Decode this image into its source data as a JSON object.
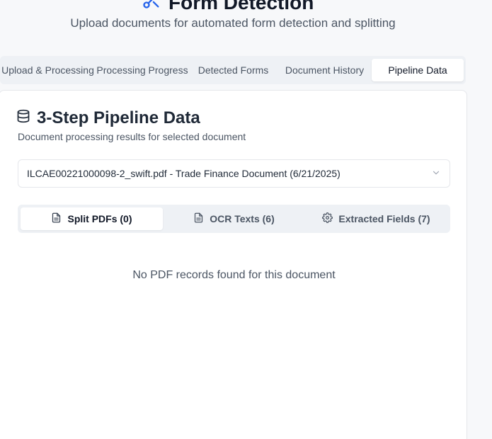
{
  "header": {
    "title": "Form Detection",
    "subtitle": "Upload documents for automated form detection and splitting"
  },
  "tabs": [
    {
      "label": "Upload & Processing",
      "active": false
    },
    {
      "label": "Processing Progress",
      "active": false
    },
    {
      "label": "Detected Forms",
      "active": false
    },
    {
      "label": "Document History",
      "active": false
    },
    {
      "label": "Pipeline Data",
      "active": true
    }
  ],
  "card": {
    "title": "3-Step Pipeline Data",
    "description": "Document processing results for selected document",
    "selected_document": "ILCAE00221000098-2_swift.pdf - Trade Finance Document (6/21/2025)",
    "subtabs": [
      {
        "label": "Split PDFs (0)",
        "icon": "file-text-icon",
        "active": true
      },
      {
        "label": "OCR Texts (6)",
        "icon": "file-text-icon",
        "active": false
      },
      {
        "label": "Extracted Fields (7)",
        "icon": "gear-icon",
        "active": false
      }
    ],
    "empty_message": "No PDF records found for this document"
  },
  "colors": {
    "accent": "#2563eb",
    "background": "#f7f8fa",
    "tab_track": "#eef1f5"
  }
}
